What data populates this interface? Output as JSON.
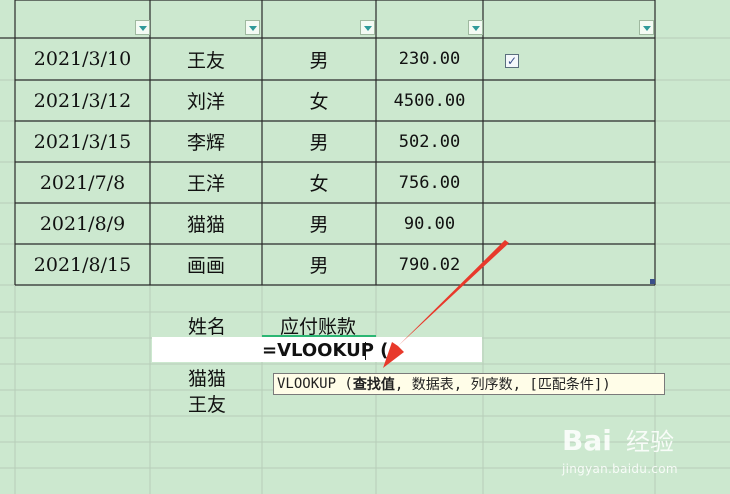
{
  "table": {
    "rows": [
      {
        "date": "2021/3/10",
        "name": "王友",
        "gender": "男",
        "amount": "230.00",
        "checked": true
      },
      {
        "date": "2021/3/12",
        "name": "刘洋",
        "gender": "女",
        "amount": "4500.00",
        "checked": false
      },
      {
        "date": "2021/3/15",
        "name": "李辉",
        "gender": "男",
        "amount": "502.00",
        "checked": false
      },
      {
        "date": "2021/7/8",
        "name": "王洋",
        "gender": "女",
        "amount": "756.00",
        "checked": false
      },
      {
        "date": "2021/8/9",
        "name": "猫猫",
        "gender": "男",
        "amount": "90.00",
        "checked": false
      },
      {
        "date": "2021/8/15",
        "name": "画画",
        "gender": "男",
        "amount": "790.02",
        "checked": false
      }
    ]
  },
  "lookup": {
    "header_name": "姓名",
    "header_amount": "应付账款",
    "formula": "=VLOOKUP (",
    "names": [
      "猫猫",
      "王友"
    ]
  },
  "tooltip": {
    "func": "VLOOKUP (",
    "active_param": "查找值",
    "rest": ", 数据表, 列序数, [匹配条件])"
  },
  "watermark": {
    "brand": "Bai",
    "site": "经验",
    "url": "jingyan.baidu.com"
  },
  "colors": {
    "background": "#cce8cf",
    "arrow": "#e8392b"
  }
}
